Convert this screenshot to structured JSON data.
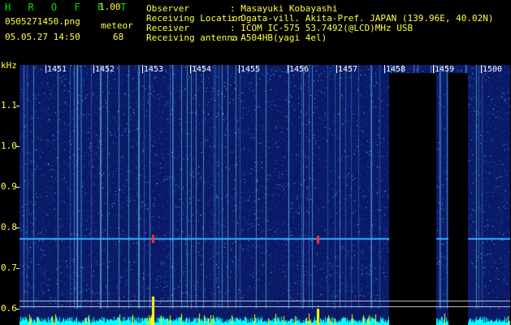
{
  "header": {
    "app_title": "H R O F F T",
    "version": "1.00",
    "filename": "0505271450.png",
    "mode": "meteor",
    "datetime": "05.05.27 14:50",
    "count": "68"
  },
  "info": [
    {
      "label": "Observer",
      "value": ": Masayuki Kobayashi"
    },
    {
      "label": "Receiving Location",
      "value": ": Ogata-vill. Akita-Pref. JAPAN (139.96E, 40.02N)"
    },
    {
      "label": "Receiver",
      "value": ": ICOM IC-575 53.7492(@LCD)MHz USB"
    },
    {
      "label": "Receiving antenna",
      "value": ": A504HB(yagi 4el)"
    }
  ],
  "y_axis": {
    "unit": "kHz",
    "ticks": [
      "1.1",
      "1.0",
      "0.9",
      "0.8",
      "0.7",
      "0.6"
    ]
  },
  "x_axis": {
    "ticks": [
      "1451",
      "1452",
      "1453",
      "1454",
      "1455",
      "1456",
      "1457",
      "1458",
      "1459",
      "1500"
    ]
  },
  "colors": {
    "text": "#ffff40",
    "title": "#00e000",
    "spectrum_bg": "#0a1a66",
    "signal": "#00ffff",
    "peak": "#ffff00"
  }
}
